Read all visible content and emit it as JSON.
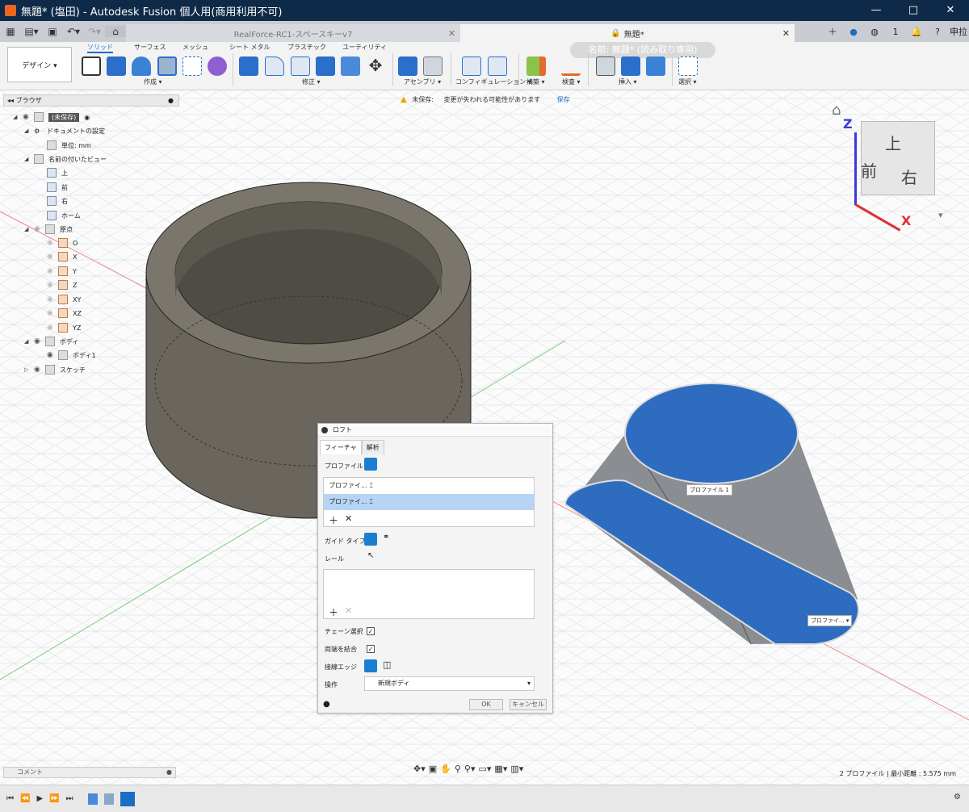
{
  "window": {
    "title": "無題* (塩田) - Autodesk Fusion 個人用(商用利用不可)",
    "min": "—",
    "max": "□",
    "close": "✕"
  },
  "tabs": [
    {
      "label": "RealForce-RC1-スペースキーv7"
    },
    {
      "label": "無題*"
    }
  ],
  "toolbar": {
    "workspace": "デザイン ▾",
    "ws_tabs": [
      "ソリッド",
      "サーフェス",
      "メッシュ",
      "シート メタル",
      "プラスチック",
      "ユーティリティ"
    ],
    "groups": [
      "作成 ▾",
      "修正 ▾",
      "アセンブリ ▾",
      "コンフィギュレーション ▾",
      "構築 ▾",
      "検査 ▾",
      "挿入 ▾",
      "選択 ▾"
    ],
    "name_badge": "名前: 無題* (読み取り専用)"
  },
  "browser": {
    "title": "ブラウザ",
    "items": [
      "(未保存)",
      "ドキュメントの設定",
      "単位: mm",
      "名前の付いたビュー",
      "上",
      "前",
      "右",
      "ホーム",
      "原点",
      "O",
      "X",
      "Y",
      "Z",
      "XY",
      "XZ",
      "YZ",
      "ボディ",
      "ボディ1",
      "スケッチ"
    ]
  },
  "notice": {
    "label": "未保存:",
    "message": "変更が失われる可能性があります",
    "save": "保存"
  },
  "viewcube": {
    "top": "上",
    "front": "前",
    "right": "右",
    "axis_z": "Z",
    "axis_x": "X"
  },
  "loft": {
    "title": "ロフト",
    "tabs": [
      "フィーチャ",
      "解析"
    ],
    "profile_label": "プロファイル",
    "profiles": [
      "プロファイ...",
      "プロファイ..."
    ],
    "guide_label": "ガイド タイプ",
    "rail_label": "レール",
    "chain_label": "チェーン選択",
    "merge_label": "両端を結合",
    "tangent_label": "接線エッジ",
    "operation_label": "操作",
    "operation_value": "新規ボディ",
    "ok": "OK",
    "cancel": "キャンセル"
  },
  "canvas_tags": {
    "profile1": "プロファイル 1",
    "profile2": "プロファイ... ▾"
  },
  "comment": {
    "label": "コメント"
  },
  "status": {
    "text": "2 プロファイル | 最小距離 : 5.575 mm"
  },
  "user": {
    "initials": "申拉"
  },
  "jobs": {
    "count": "1"
  }
}
